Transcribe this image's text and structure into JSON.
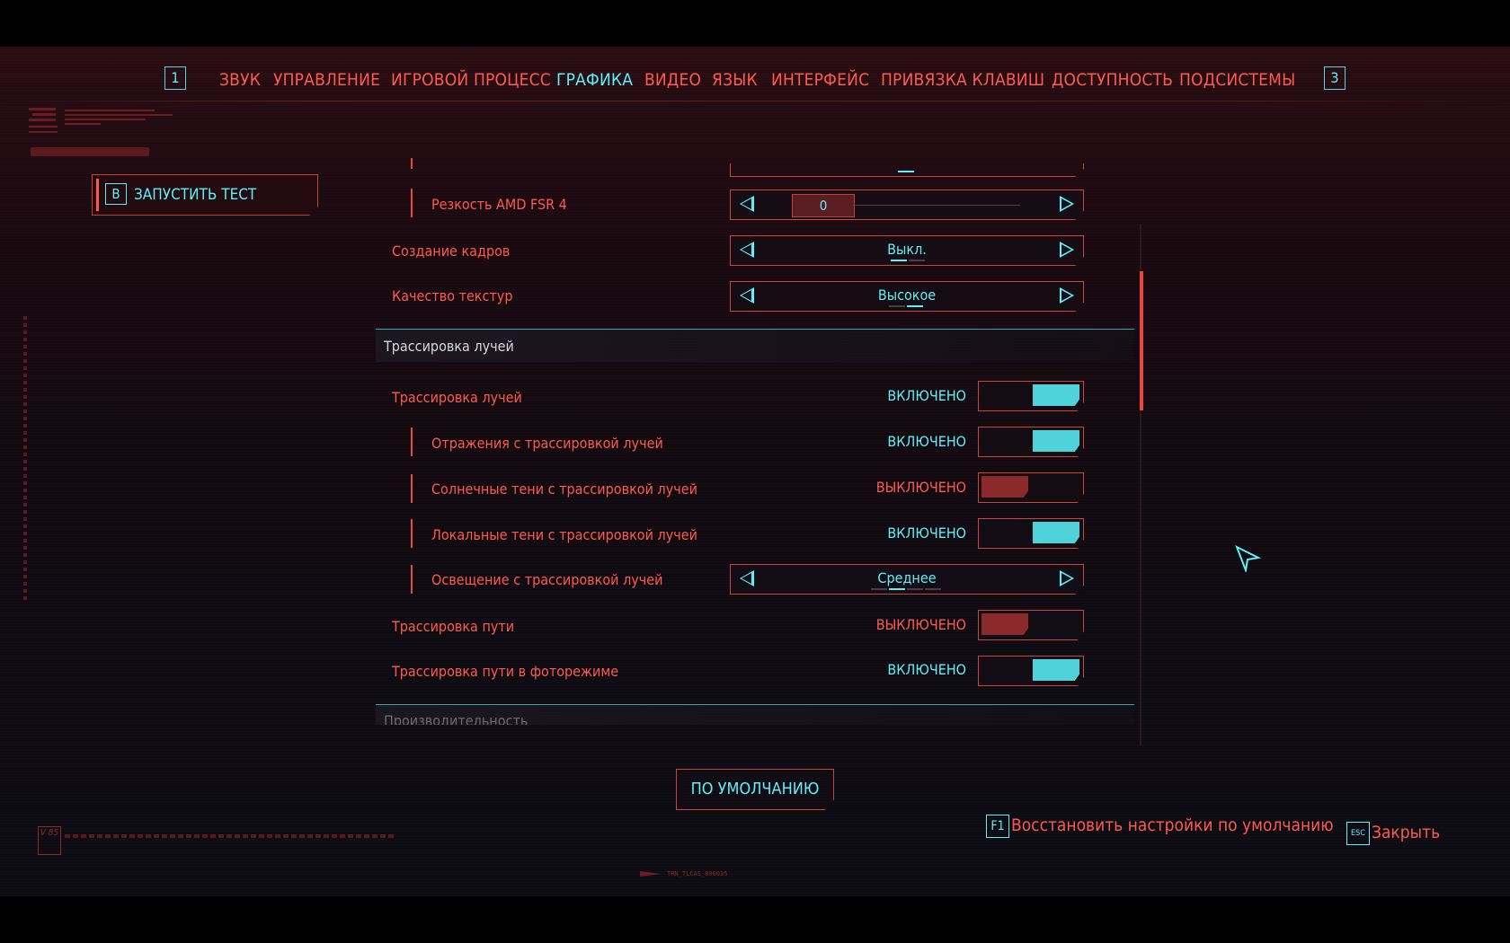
{
  "nav": {
    "left_key": "1",
    "right_key": "3",
    "tabs": [
      "ЗВУК",
      "УПРАВЛЕНИЕ",
      "ИГРОВОЙ ПРОЦЕСС",
      "ГРАФИКА",
      "ВИДЕО",
      "ЯЗЫК",
      "ИНТЕРФЕЙС",
      "ПРИВЯЗКА КЛАВИШ",
      "ДОСТУПНОСТЬ",
      "ПОДСИСТЕМЫ"
    ],
    "active_tab": "ГРАФИКА"
  },
  "benchmark": {
    "key": "B",
    "label": "ЗАПУСТИТЬ ТЕСТ"
  },
  "settings": {
    "fsr_sharpness": {
      "label": "Резкость AMD FSR 4",
      "value": "0"
    },
    "frame_gen": {
      "label": "Создание кадров",
      "value": "Выкл."
    },
    "texture_quality": {
      "label": "Качество текстур",
      "value": "Высокое"
    },
    "rt_section_title": "Трассировка лучей",
    "ray_tracing": {
      "label": "Трассировка лучей",
      "state": "ВКЛЮЧЕНО"
    },
    "rt_reflections": {
      "label": "Отражения с трассировкой лучей",
      "state": "ВКЛЮЧЕНО"
    },
    "rt_sun_shadows": {
      "label": "Солнечные тени с трассировкой лучей",
      "state": "ВЫКЛЮЧЕНО"
    },
    "rt_local_shadows": {
      "label": "Локальные тени с трассировкой лучей",
      "state": "ВКЛЮЧЕНО"
    },
    "rt_lighting": {
      "label": "Освещение с трассировкой лучей",
      "value": "Среднее"
    },
    "path_tracing": {
      "label": "Трассировка пути",
      "state": "ВЫКЛЮЧЕНО"
    },
    "path_tracing_photo": {
      "label": "Трассировка пути в фоторежиме",
      "state": "ВКЛЮЧЕНО"
    },
    "next_section_title": "Производительность"
  },
  "footer": {
    "default_button": "ПО УМОЛЧАНИЮ",
    "restore_key": "F1",
    "restore_label": "Восстановить настройки по умолчанию",
    "close_key": "ESC",
    "close_label": "Закрыть",
    "version_badge": "V 85",
    "build_code": "TRN_TLCAS_800035"
  },
  "colors": {
    "accent_cyan": "#5ef0f6",
    "accent_red": "#ff5a4e",
    "toggle_on": "#4fd2da",
    "toggle_off": "#8a2a2a"
  }
}
